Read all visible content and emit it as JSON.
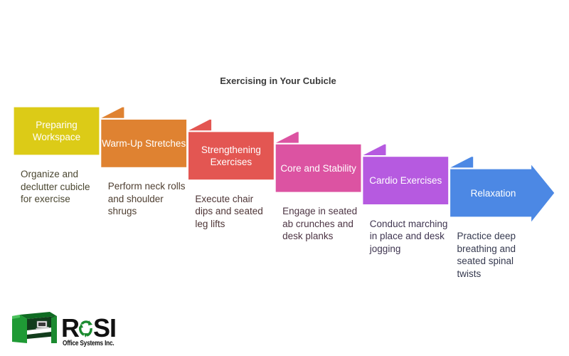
{
  "title": "Exercising in Your Cubicle",
  "steps": [
    {
      "label": "Preparing Workspace",
      "description": "Organize and declutter cubicle for exercise",
      "color": "#DCCB17",
      "text_color": "#4a4630"
    },
    {
      "label": "Warm-Up Stretches",
      "description": "Perform neck rolls and shoulder shrugs",
      "color": "#DF8231",
      "text_color": "#4e3e30"
    },
    {
      "label": "Strengthening Exercises",
      "description": "Execute chair dips and seated leg lifts",
      "color": "#E35652",
      "text_color": "#4e3536"
    },
    {
      "label": "Core and Stability",
      "description": "Engage in seated ab crunches and desk planks",
      "color": "#DC53A2",
      "text_color": "#4d3544"
    },
    {
      "label": "Cardio Exercises",
      "description": "Conduct marching in place and desk jogging",
      "color": "#B65AE0",
      "text_color": "#3f3550"
    },
    {
      "label": "Relaxation",
      "description": "Practice deep breathing and seated spinal twists",
      "color": "#4C88E4",
      "text_color": "#35394f"
    }
  ],
  "logo": {
    "word_start": "R",
    "word_end": "SI",
    "subtitle": "Office Systems Inc.",
    "icon": "cubicle-icon",
    "o_icon": "recycle-arrows-icon",
    "brand_color": "#1a8a2e"
  }
}
